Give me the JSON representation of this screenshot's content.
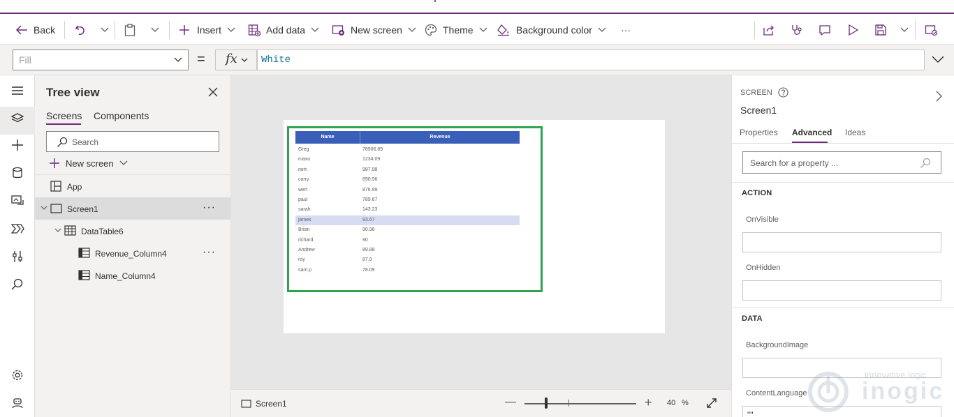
{
  "commandbar": {
    "back": "Back",
    "insert": "Insert",
    "add_data": "Add data",
    "new_screen": "New screen",
    "theme": "Theme",
    "background_color": "Background color",
    "more": "···"
  },
  "formula_bar": {
    "property": "Fill",
    "equals": "=",
    "fx": "fx",
    "formula": "White"
  },
  "tree_view": {
    "title": "Tree view",
    "tabs": [
      "Screens",
      "Components"
    ],
    "search_placeholder": "Search",
    "new_screen": "New screen",
    "nodes": {
      "app": "App",
      "screen": "Screen1",
      "datatable": "DataTable6",
      "revenue_col": "Revenue_Column4",
      "name_col": "Name_Column4"
    },
    "more": "···"
  },
  "datatable": {
    "headers": [
      "Name",
      "Revenue"
    ],
    "rows": [
      [
        "Greg",
        "78906.89"
      ],
      [
        "maxo",
        "1234.09"
      ],
      [
        "nert",
        "987.98"
      ],
      [
        "carry",
        "890.56"
      ],
      [
        "wert",
        "876.99"
      ],
      [
        "paul",
        "789.67"
      ],
      [
        "sarah",
        "143.23"
      ],
      [
        "james",
        "93.67"
      ],
      [
        "Brian",
        "90.98"
      ],
      [
        "richard",
        "90"
      ],
      [
        "Andrew",
        "89.88"
      ],
      [
        "roy",
        "87.9"
      ],
      [
        "sam.p",
        "78.09"
      ]
    ],
    "selected_row": 7
  },
  "statusbar": {
    "screen": "Screen1",
    "minus": "—",
    "plus": "+",
    "zoom": "40",
    "percent": "%"
  },
  "properties": {
    "kind": "SCREEN",
    "name": "Screen1",
    "tabs": [
      "Properties",
      "Advanced",
      "Ideas"
    ],
    "search_placeholder": "Search for a property ...",
    "sections": {
      "action": "ACTION",
      "data": "DATA"
    },
    "labels": {
      "onvisible": "OnVisible",
      "onhidden": "OnHidden",
      "bgimage": "BackgroundImage",
      "contentlang": "ContentLanguage"
    },
    "contentlang_value": "\"\""
  },
  "watermark": {
    "tagline": "innovative logic",
    "brand": "inogic"
  },
  "colors": {
    "accent": "#6b2d7a",
    "table_header": "#3a5fb8",
    "selection_border": "#2ea44f",
    "selected_row": "#d7dcf2"
  }
}
